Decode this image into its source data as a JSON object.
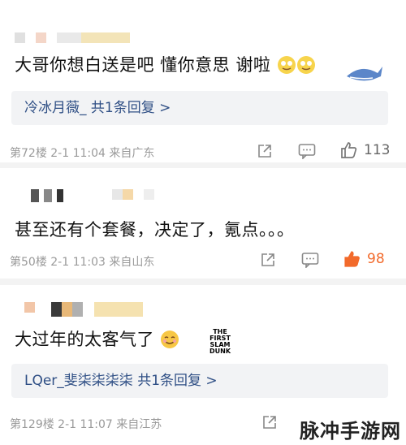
{
  "comments": [
    {
      "text": "大哥你想白送是吧 懂你意思 谢啦",
      "reply": "冷冰月薇_ 共1条回复 >",
      "meta": "第72楼 2-1 11:04 来自广东",
      "likes": "113"
    },
    {
      "text": "甚至还有个套餐，决定了，氪点。。。",
      "meta": "第50楼 2-1 11:03 来自山东",
      "likes": "98"
    },
    {
      "text": "大过年的太客气了",
      "reply": "LQer_斐柒柒柒柒 共1条回复 >",
      "meta": "第129楼 2-1 11:07 来自江苏"
    }
  ],
  "sticker_text": "THE FIRST SLAM DUNK",
  "watermark": "脉冲手游网",
  "colors": {
    "link_blue": "#2f4f85",
    "like_orange": "#f26a2b",
    "meta_gray": "#9a9a9a"
  },
  "icons": [
    "share-icon",
    "comment-icon",
    "like-icon",
    "emoji-icon",
    "whale-icon"
  ]
}
